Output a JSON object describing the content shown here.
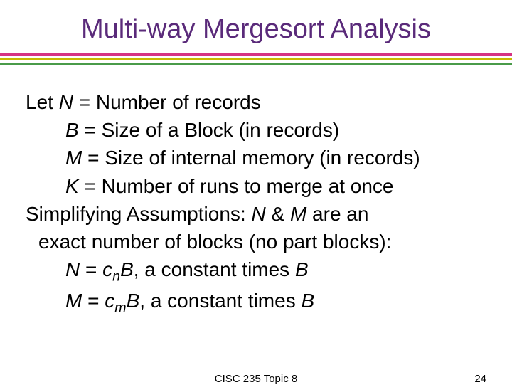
{
  "title": "Multi-way Mergesort Analysis",
  "lines": {
    "let": "Let ",
    "n_var": "N",
    "n_def": " = Number of records",
    "b_var": "B",
    "b_def": " = Size of a Block (in records)",
    "m_var": "M",
    "m_def": " = Size of internal memory (in records)",
    "k_var": "K",
    "k_def": " = Number of runs to merge at once",
    "simp1": "Simplifying Assumptions:  ",
    "nv": "N",
    "amp": " & ",
    "mv": "M",
    "simp2": " are an",
    "simp3": "exact number of blocks (no part blocks):",
    "neq_n": "N",
    "neq_eq": " = ",
    "neq_c": "c",
    "neq_sub": "n",
    "neq_b": "B",
    "neq_tail": ", a constant times ",
    "neq_b2": "B",
    "meq_m": "M",
    "meq_eq": " = ",
    "meq_c": "c",
    "meq_sub": "m",
    "meq_b": "B",
    "meq_tail": ", a constant times ",
    "meq_b2": "B"
  },
  "footer": {
    "center": "CISC 235 Topic 8",
    "page": "24"
  }
}
